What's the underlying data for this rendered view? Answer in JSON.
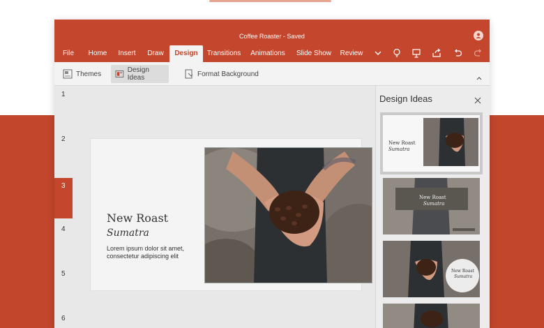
{
  "window": {
    "title": "Coffee Roaster - Saved"
  },
  "ribbon": {
    "tabs": [
      "File",
      "Home",
      "Insert",
      "Draw",
      "Design",
      "Transitions",
      "Animations",
      "Slide Show",
      "Review"
    ],
    "active_tab": "Design",
    "right_icons": [
      "chevron-down-icon",
      "lightbulb-icon",
      "present-icon",
      "share-icon",
      "undo-icon",
      "redo-icon"
    ]
  },
  "toolbar": {
    "themes_label": "Themes",
    "design_ideas_label": "Design Ideas",
    "format_background_label": "Format Background"
  },
  "thumbnails": {
    "numbers": [
      "1",
      "2",
      "3",
      "4",
      "5",
      "6"
    ],
    "selected": "3"
  },
  "slide": {
    "title": "New Roast",
    "subtitle": "Sumatra",
    "body": "Lorem ipsum dolor sit amet, consectetur adipiscing elit"
  },
  "design_ideas": {
    "title": "Design Ideas",
    "idea1": {
      "title": "New Roast",
      "subtitle": "Sumatra"
    },
    "idea2": {
      "title": "New Roast",
      "subtitle": "Sumatra"
    },
    "idea3": {
      "title": "New Roast",
      "subtitle": "Sumatra"
    }
  },
  "colors": {
    "accent": "#c4462c",
    "backdrop": "#c2462c"
  }
}
